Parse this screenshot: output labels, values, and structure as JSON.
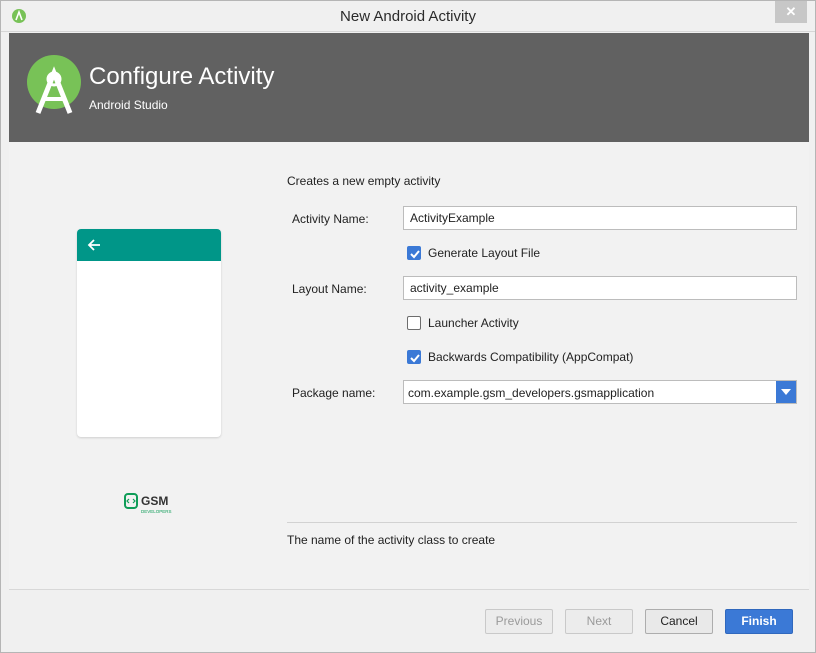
{
  "window": {
    "title": "New Android Activity",
    "close_glyph": "✕"
  },
  "banner": {
    "title": "Configure Activity",
    "subtitle": "Android Studio"
  },
  "preview": {
    "logo_text": "GSM DEVELOPERS"
  },
  "form": {
    "description": "Creates a new empty activity",
    "activity_name_label": "Activity Name:",
    "activity_name_value": "ActivityExample",
    "generate_layout_label": "Generate Layout File",
    "generate_layout_checked": true,
    "layout_name_label": "Layout Name:",
    "layout_name_value": "activity_example",
    "launcher_activity_label": "Launcher Activity",
    "launcher_activity_checked": false,
    "backwards_compat_label": "Backwards Compatibility (AppCompat)",
    "backwards_compat_checked": true,
    "package_name_label": "Package name:",
    "package_name_value": "com.example.gsm_developers.gsmapplication",
    "hint": "The name of the activity class to create"
  },
  "buttons": {
    "previous": "Previous",
    "next": "Next",
    "cancel": "Cancel",
    "finish": "Finish"
  },
  "colors": {
    "banner_bg": "#616161",
    "accent": "#3b79d6",
    "appbar": "#009688",
    "studio_green": "#78c257"
  }
}
